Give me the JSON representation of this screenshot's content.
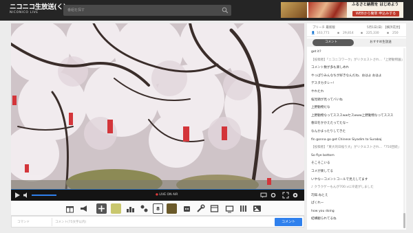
{
  "header": {
    "logo_main": "ニコニコ生放送(く)",
    "logo_sub": "NICONICO LIVE",
    "search_placeholder": "番組を探す",
    "ad": {
      "text1": "ふるさと納税を",
      "text2": "はじめよう",
      "cta": "WEBから簡単",
      "cta2": "申込みする"
    }
  },
  "player": {
    "live_label": "LIVE ON AIR"
  },
  "toolbar": {
    "icons": [
      "gift-icon",
      "megaphone-icon",
      "plus-icon",
      "emote-icon",
      "ranking-icon",
      "game-icon",
      "number-eight-icon",
      "card-icon",
      "robot-icon",
      "tool-icon",
      "screen-icon",
      "tv-icon",
      "bars-icon",
      "gallery-icon"
    ]
  },
  "commentbar": {
    "command_placeholder": "コマンド",
    "comment_placeholder": "コメント(75文字以内)",
    "send_label": "コメント"
  },
  "panel": {
    "channel": "プリーチ 最新版",
    "date": "5月1日(日) 【横浜花見】",
    "stats": [
      "163,771",
      "29,814",
      "225,330",
      "250"
    ],
    "tab_comment": "コメント",
    "tab_related": "おすすめ生放送",
    "comments": [
      {
        "text": "get it?",
        "sys": false
      },
      {
        "text": "【投稿者】「ニコニコワーク」がリクエストされ...「上野動物園」",
        "sys": true
      },
      {
        "text": "コメント数が多も楽しめれ",
        "sys": false
      },
      {
        "text": "やっぱりみんなちが好きなんだね、おはよ おはよ",
        "sys": false
      },
      {
        "text": "デスタカタレ~!",
        "sys": false
      },
      {
        "text": "やれたれ",
        "sys": false
      },
      {
        "text": "桜見頭が見ってバいね",
        "sys": false
      },
      {
        "text": "上野動物だな",
        "sys": false
      },
      {
        "text": "上野動物なってスススwwセスwww上野動物なってススス",
        "sys": false
      },
      {
        "text": "春日をかかえたってたな~",
        "sys": false
      },
      {
        "text": "なんかまったりしてきた",
        "sys": false
      },
      {
        "text": "fin gonna go get Chinese Siyadim to Surabaj",
        "sys": false
      },
      {
        "text": "【投稿者】「東大的日桜り大」がリクエストされ...「750回続」",
        "sys": true
      },
      {
        "text": "So flye bottom",
        "sys": false
      },
      {
        "text": "そこそこいる",
        "sys": false
      },
      {
        "text": "コメが楽してる",
        "sys": false
      },
      {
        "text": "いやなーコメントコールで見えしてます",
        "sys": false
      },
      {
        "text": "♪ クラクゲーもんが700.vに冷遊がしました",
        "sys": true
      },
      {
        "text": "巧知.ねとえ",
        "sys": false
      },
      {
        "text": "ぱくれー",
        "sys": false
      },
      {
        "text": "how you doing",
        "sys": false
      },
      {
        "text": "結構観られてるね",
        "sys": false
      }
    ]
  }
}
